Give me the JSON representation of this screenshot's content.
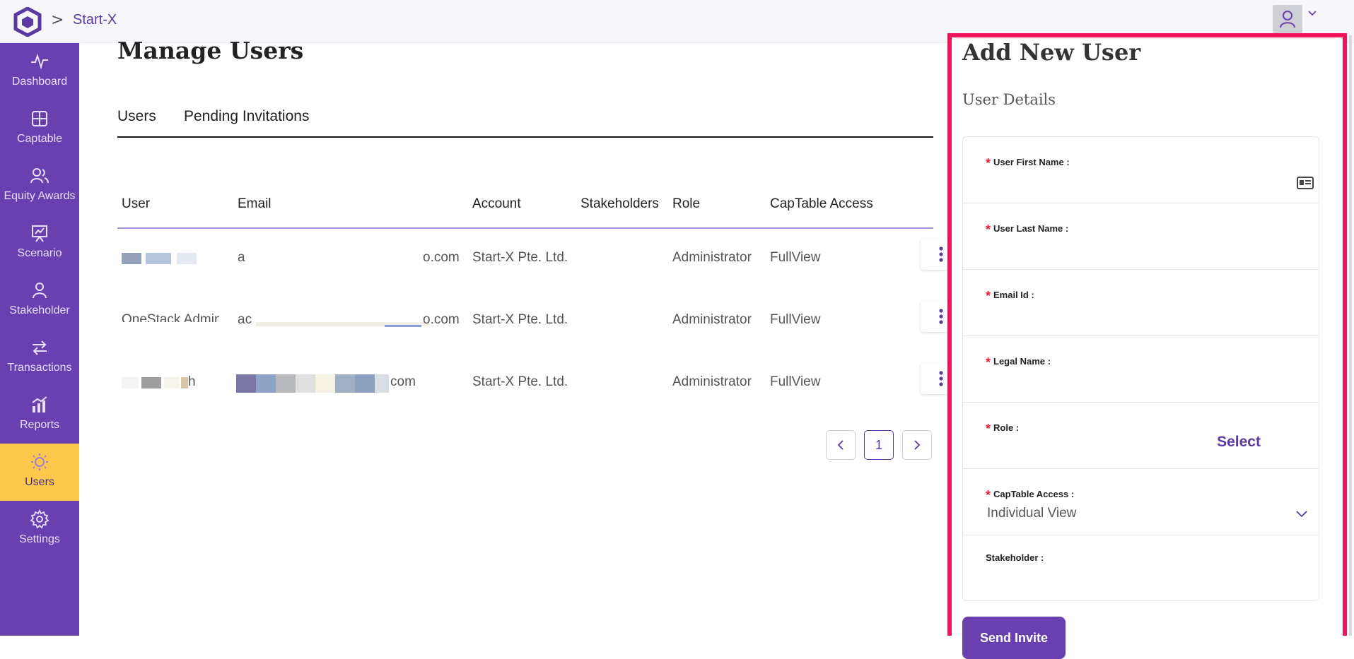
{
  "header": {
    "breadcrumb_sep": ">",
    "breadcrumb": "Start-X"
  },
  "sidebar": {
    "items": [
      {
        "label": "Dashboard",
        "icon": "dashboard-icon"
      },
      {
        "label": "Captable",
        "icon": "captable-icon"
      },
      {
        "label": "Equity Awards",
        "icon": "equity-awards-icon"
      },
      {
        "label": "Scenario",
        "icon": "scenario-icon"
      },
      {
        "label": "Stakeholder",
        "icon": "stakeholder-icon"
      },
      {
        "label": "Transactions",
        "icon": "transactions-icon"
      },
      {
        "label": "Reports",
        "icon": "reports-icon"
      },
      {
        "label": "Users",
        "icon": "users-icon",
        "active": true
      },
      {
        "label": "Settings",
        "icon": "settings-icon"
      }
    ]
  },
  "main": {
    "title": "Manage Users",
    "tabs": [
      {
        "label": "Users"
      },
      {
        "label": "Pending Invitations"
      }
    ],
    "table": {
      "columns": [
        "User",
        "Email",
        "Account",
        "Stakeholders",
        "Role",
        "CapTable Access"
      ],
      "rows": [
        {
          "user": "",
          "email_prefix": "a",
          "email_suffix": "o.com",
          "account": "Start-X Pte. Ltd.",
          "stakeholders": "",
          "role": "Administrator",
          "access": "FullView"
        },
        {
          "user": "OneStack Admin",
          "email_prefix": "ac",
          "email_suffix": "o.com",
          "account": "Start-X Pte. Ltd.",
          "stakeholders": "",
          "role": "Administrator",
          "access": "FullView"
        },
        {
          "user": "h",
          "email_prefix": "",
          "email_suffix": "com",
          "account": "Start-X Pte. Ltd.",
          "stakeholders": "",
          "role": "Administrator",
          "access": "FullView"
        }
      ]
    },
    "pagination": {
      "prev": "<",
      "current": "1",
      "next": ">"
    }
  },
  "panel": {
    "title": "Add New User",
    "subtitle": "User Details",
    "fields": [
      {
        "label": "User First Name :",
        "required": "*"
      },
      {
        "label": "User Last Name :",
        "required": "*"
      },
      {
        "label": "Email Id :",
        "required": "*"
      },
      {
        "label": "Legal Name :",
        "required": "*"
      },
      {
        "label": "Role :",
        "required": "*",
        "select_label": "Select"
      },
      {
        "label": "CapTable Access :",
        "required": "*",
        "value": "Individual View"
      },
      {
        "label": "Stakeholder :"
      }
    ],
    "submit_label": "Send Invite"
  },
  "colors": {
    "brand": "#6a3fb0",
    "active_nav": "#fbc84c",
    "highlight_border": "#f0155a",
    "required": "#e8203a"
  }
}
